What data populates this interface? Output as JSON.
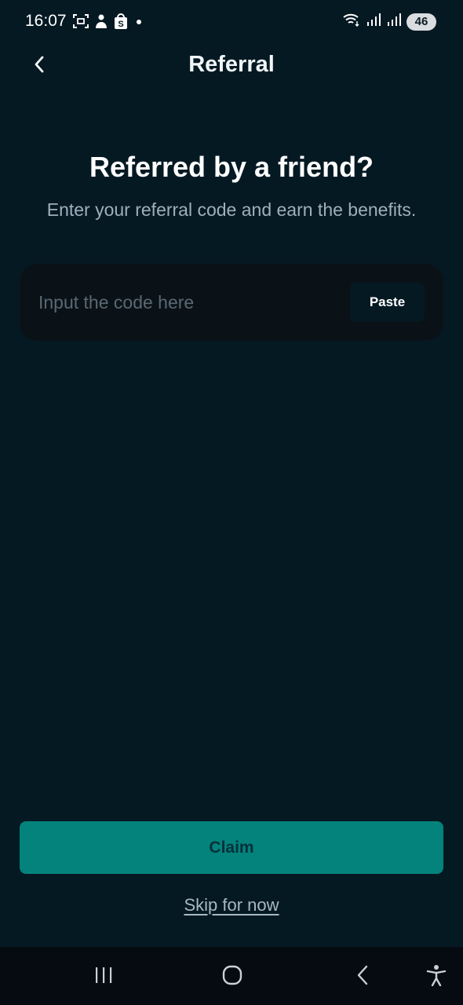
{
  "status_bar": {
    "time": "16:07",
    "battery": "46",
    "left_icons": [
      "screenshot-icon",
      "app-notification-icon",
      "shopping-bag-icon",
      "dot-icon"
    ],
    "right_icons": [
      "wifi-icon",
      "signal-icon",
      "signal-icon"
    ]
  },
  "header": {
    "title": "Referral",
    "back_icon": "chevron-left-icon"
  },
  "main": {
    "heading": "Referred by a friend?",
    "subheading": "Enter your referral code and earn the benefits.",
    "code_input": {
      "placeholder": "Input the code here",
      "value": ""
    },
    "paste_label": "Paste",
    "claim_label": "Claim",
    "skip_label": "Skip for now"
  },
  "nav_bar": {
    "items": [
      "recent-apps-icon",
      "home-icon",
      "back-icon",
      "accessibility-icon"
    ]
  },
  "colors": {
    "background": "#051923",
    "input_bg": "#0a1218",
    "accent": "#03837b",
    "muted_text": "#9fb0bb"
  }
}
